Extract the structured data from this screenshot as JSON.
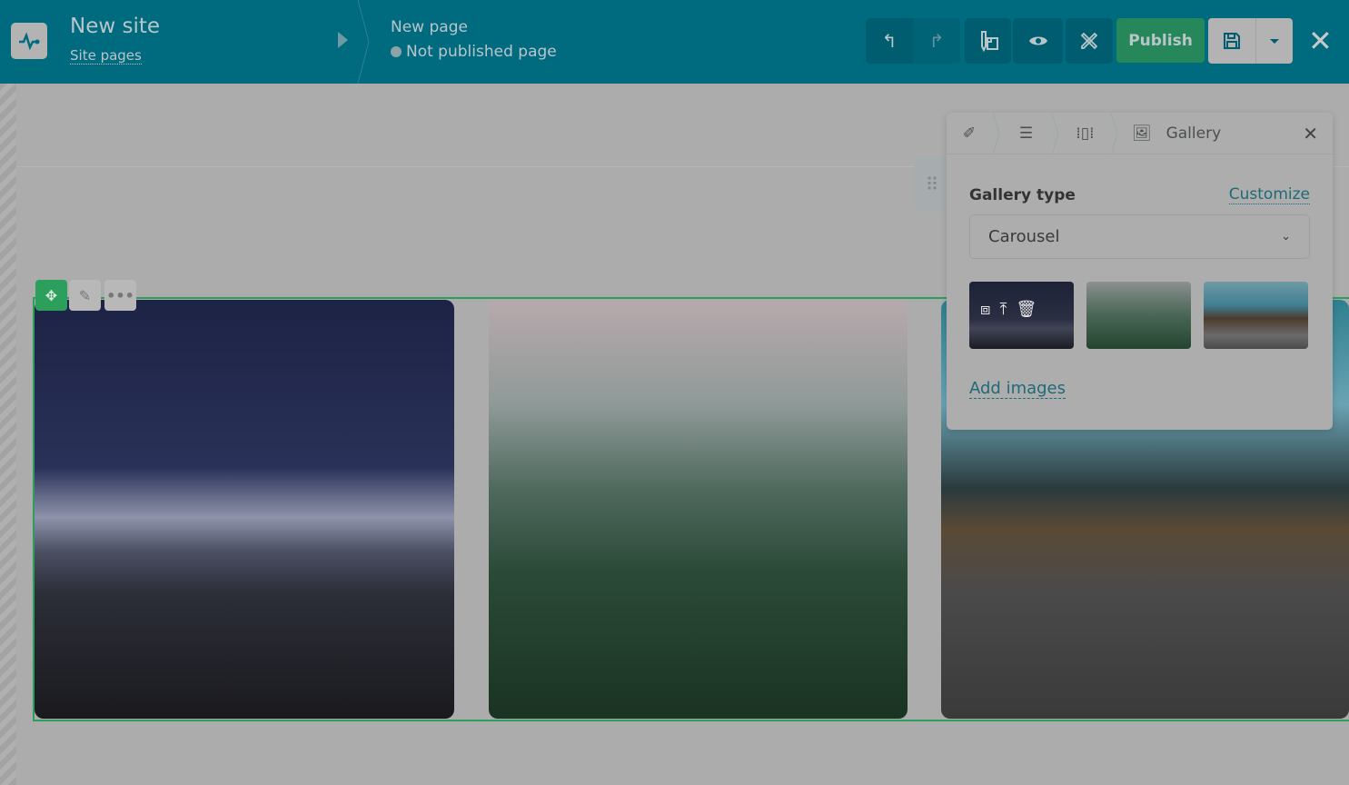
{
  "header": {
    "site_title": "New site",
    "site_pages_link": "Site pages",
    "page_title": "New page",
    "page_status": "Not published page",
    "publish_label": "Publish"
  },
  "panel": {
    "breadcrumb_title": "Gallery",
    "gallery_type_label": "Gallery type",
    "customize_link": "Customize",
    "gallery_type_value": "Carousel",
    "add_images_link": "Add images"
  },
  "colors": {
    "header": "#006a7f",
    "publish": "#25875a",
    "accent": "#2d9f5c",
    "link": "#1f6a78"
  }
}
